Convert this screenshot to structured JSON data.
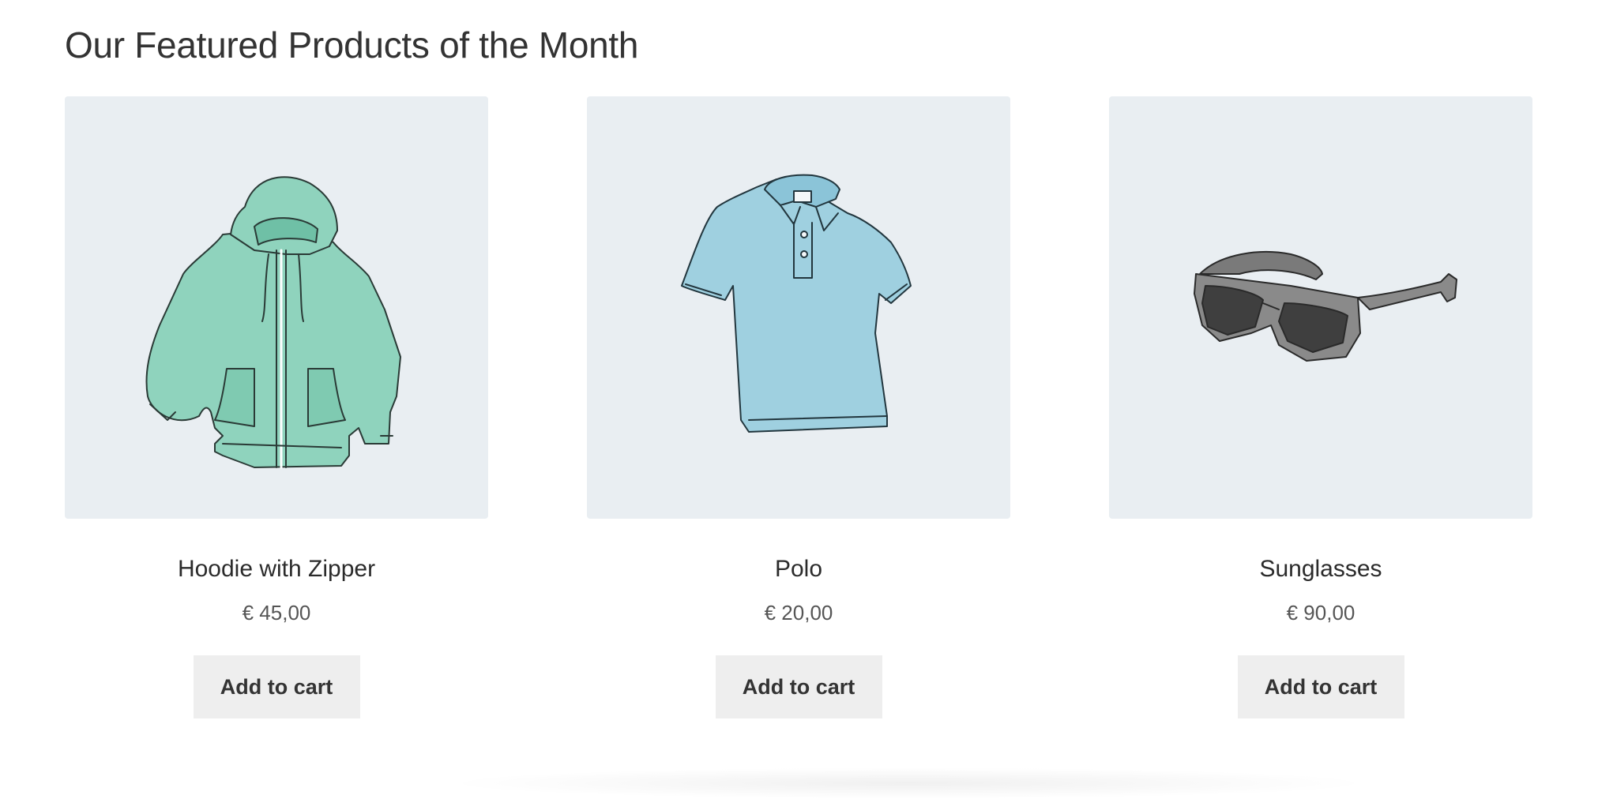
{
  "section": {
    "title": "Our Featured Products of the Month"
  },
  "products": [
    {
      "name": "Hoodie with Zipper",
      "price": "€ 45,00",
      "button_label": "Add to cart",
      "image_icon": "hoodie-icon",
      "image_color": "#8fd3bd"
    },
    {
      "name": "Polo",
      "price": "€ 20,00",
      "button_label": "Add to cart",
      "image_icon": "polo-shirt-icon",
      "image_color": "#9fd0e0"
    },
    {
      "name": "Sunglasses",
      "price": "€ 90,00",
      "button_label": "Add to cart",
      "image_icon": "sunglasses-icon",
      "image_color": "#7a7a7a"
    }
  ],
  "colors": {
    "thumb_background": "#e9eef2",
    "button_background": "#eeeeee",
    "text": "#333333"
  }
}
